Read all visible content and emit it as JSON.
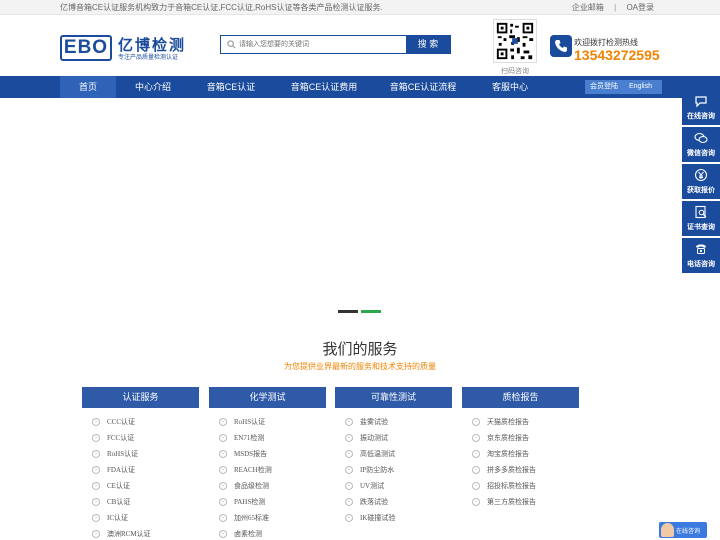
{
  "topbar": {
    "intro": "亿博音箱CE认证服务机构致力于音箱CE认证,FCC认证,RoHS认证等各类产品检测认证服务.",
    "links": [
      "企业邮箱",
      "|",
      "OA登录"
    ]
  },
  "logo": {
    "mark": "EBO",
    "name": "亿博检测",
    "slogan": "专注产品质量检测认证"
  },
  "search": {
    "placeholder": "请输入您想要的关键词",
    "button": "搜 索"
  },
  "qr": {
    "label": "扫码咨询"
  },
  "hotline": {
    "title": "欢迎拨打检测热线",
    "number": "13543272595"
  },
  "nav": {
    "items": [
      "首页",
      "中心介绍",
      "音箱CE认证",
      "音箱CE认证费用",
      "音箱CE认证流程",
      "客服中心"
    ],
    "active_index": 0,
    "login": "会员登陆",
    "english": "English"
  },
  "banner": {
    "dots": 2,
    "active_dot": 1
  },
  "services": {
    "title": "我们的服务",
    "subtitle": "为您提供业界最新的服务和技术支持的质量",
    "columns": [
      {
        "title": "认证服务",
        "items": [
          "CCC认证",
          "FCC认证",
          "RoHS认证",
          "FDA认证",
          "CE认证",
          "CB认证",
          "IC认证",
          "澳洲RCM认证"
        ]
      },
      {
        "title": "化学测试",
        "items": [
          "RoHS认证",
          "EN71检测",
          "MSDS报告",
          "REACH检测",
          "食品级检测",
          "PAHS检测",
          "加州65标准",
          "卤素检测"
        ]
      },
      {
        "title": "可靠性测试",
        "items": [
          "盐雾试验",
          "振动测试",
          "高低温测试",
          "IP防尘防水",
          "UV测试",
          "跌落试验",
          "IK碰撞试验"
        ]
      },
      {
        "title": "质检报告",
        "items": [
          "天猫质检报告",
          "京东质检报告",
          "淘宝质检报告",
          "拼多多质检报告",
          "招投标质检报告",
          "第三方质检报告"
        ]
      }
    ]
  },
  "float": {
    "items": [
      {
        "label": "在线咨询",
        "icon": "chat-bubble-icon"
      },
      {
        "label": "微信咨询",
        "icon": "wechat-icon"
      },
      {
        "label": "获取报价",
        "icon": "yen-coin-icon"
      },
      {
        "label": "证书查询",
        "icon": "certificate-search-icon"
      },
      {
        "label": "电话咨询",
        "icon": "phone-icon"
      }
    ]
  },
  "chat": {
    "label": "在线咨询"
  },
  "colors": {
    "primary": "#1b4b9c",
    "accent": "#f08300",
    "column_header": "#2e5aa8",
    "dot_active": "#2aa84a",
    "dot_inactive": "#333333"
  }
}
